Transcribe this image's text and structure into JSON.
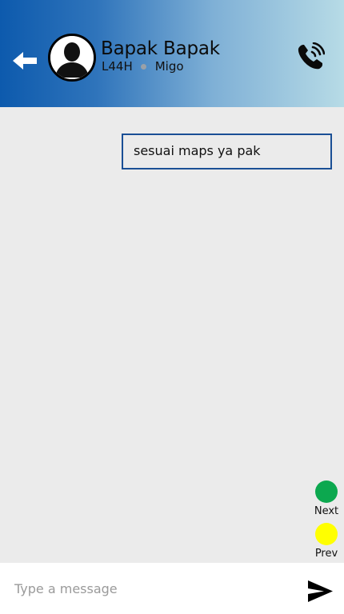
{
  "header": {
    "contact_name": "Bapak Bapak",
    "plate": "L44H",
    "vehicle": "Migo",
    "back_icon": "back-arrow-icon",
    "call_icon": "phone-call-icon",
    "avatar_icon": "person-avatar-icon"
  },
  "messages": [
    {
      "text": "sesuai maps ya pak",
      "side": "right"
    }
  ],
  "nav": {
    "next_label": "Next",
    "prev_label": "Prev",
    "next_color": "#0ca84f",
    "prev_color": "#ffff00"
  },
  "composer": {
    "placeholder": "Type a message",
    "value": "",
    "send_icon": "send-icon"
  },
  "colors": {
    "header_start": "#0d5aad",
    "header_end": "#b7dbe6",
    "bubble_border": "#1a4f95",
    "background": "#ebebeb"
  }
}
